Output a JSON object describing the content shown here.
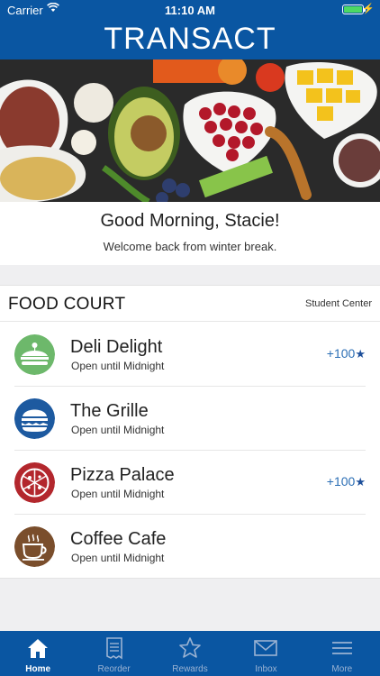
{
  "status": {
    "carrier": "Carrier",
    "time": "11:10 AM"
  },
  "header": {
    "title": "TRANSACT"
  },
  "greeting": {
    "title": "Good Morning, Stacie!",
    "subtitle": "Welcome back from winter break."
  },
  "food_court": {
    "title": "FOOD COURT",
    "location": "Student Center",
    "items": [
      {
        "name": "Deli Delight",
        "hours": "Open until Midnight",
        "points": "+100",
        "icon": "sandwich-icon",
        "color": "#6db86b"
      },
      {
        "name": "The Grille",
        "hours": "Open until Midnight",
        "points": "",
        "icon": "burger-icon",
        "color": "#1d5aa0"
      },
      {
        "name": "Pizza Palace",
        "hours": "Open until Midnight",
        "points": "+100",
        "icon": "pizza-icon",
        "color": "#b3272d"
      },
      {
        "name": "Coffee Cafe",
        "hours": "Open until Midnight",
        "points": "",
        "icon": "coffee-cup-icon",
        "color": "#7a4e2c"
      }
    ]
  },
  "tabs": [
    {
      "label": "Home",
      "icon": "home-icon",
      "active": true
    },
    {
      "label": "Reorder",
      "icon": "receipt-icon",
      "active": false
    },
    {
      "label": "Rewards",
      "icon": "star-icon",
      "active": false
    },
    {
      "label": "Inbox",
      "icon": "envelope-icon",
      "active": false
    },
    {
      "label": "More",
      "icon": "menu-icon",
      "active": false
    }
  ]
}
